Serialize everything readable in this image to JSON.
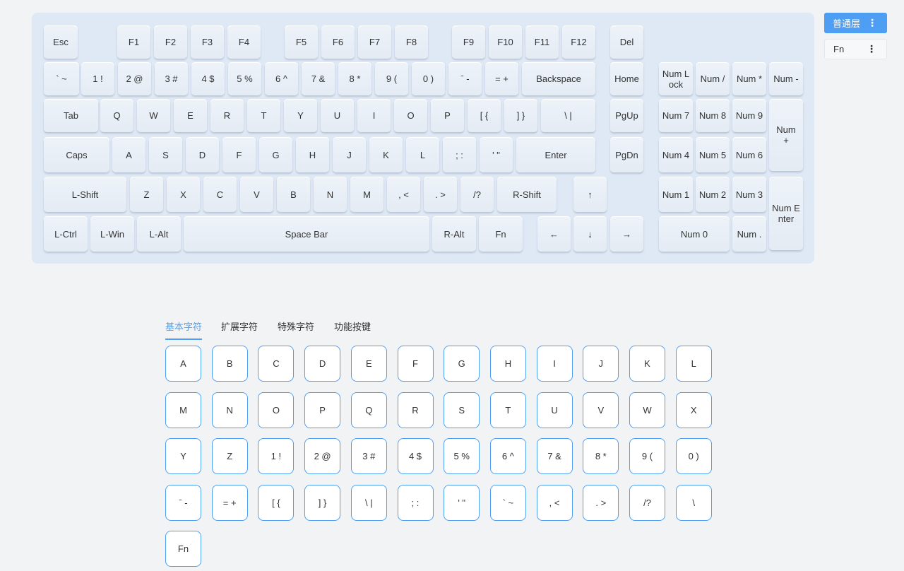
{
  "keyboard": {
    "keys": [
      {
        "id": "esc",
        "label": "Esc"
      },
      {
        "id": "f1",
        "label": "F1"
      },
      {
        "id": "f2",
        "label": "F2"
      },
      {
        "id": "f3",
        "label": "F3"
      },
      {
        "id": "f4",
        "label": "F4"
      },
      {
        "id": "f5",
        "label": "F5"
      },
      {
        "id": "f6",
        "label": "F6"
      },
      {
        "id": "f7",
        "label": "F7"
      },
      {
        "id": "f8",
        "label": "F8"
      },
      {
        "id": "f9",
        "label": "F9"
      },
      {
        "id": "f10",
        "label": "F10"
      },
      {
        "id": "f11",
        "label": "F11"
      },
      {
        "id": "f12",
        "label": "F12"
      },
      {
        "id": "del",
        "label": "Del"
      },
      {
        "id": "backtick",
        "label": "` ~"
      },
      {
        "id": "1",
        "label": "1 !"
      },
      {
        "id": "2",
        "label": "2 @"
      },
      {
        "id": "3",
        "label": "3 #"
      },
      {
        "id": "4",
        "label": "4 $"
      },
      {
        "id": "5",
        "label": "5 %"
      },
      {
        "id": "6",
        "label": "6 ^"
      },
      {
        "id": "7",
        "label": "7 &"
      },
      {
        "id": "8",
        "label": "8 *"
      },
      {
        "id": "9",
        "label": "9 ("
      },
      {
        "id": "0",
        "label": "0 )"
      },
      {
        "id": "minus",
        "label": "ˉ -"
      },
      {
        "id": "equal",
        "label": "= +"
      },
      {
        "id": "backspace",
        "label": "Backspace"
      },
      {
        "id": "home",
        "label": "Home"
      },
      {
        "id": "numlock",
        "label": "Num L\nock"
      },
      {
        "id": "numslash",
        "label": "Num /"
      },
      {
        "id": "numstar",
        "label": "Num *"
      },
      {
        "id": "numminus",
        "label": "Num -"
      },
      {
        "id": "tab",
        "label": "Tab"
      },
      {
        "id": "q",
        "label": "Q"
      },
      {
        "id": "w",
        "label": "W"
      },
      {
        "id": "e",
        "label": "E"
      },
      {
        "id": "r",
        "label": "R"
      },
      {
        "id": "t",
        "label": "T"
      },
      {
        "id": "y",
        "label": "Y"
      },
      {
        "id": "u",
        "label": "U"
      },
      {
        "id": "i",
        "label": "I"
      },
      {
        "id": "o",
        "label": "O"
      },
      {
        "id": "p",
        "label": "P"
      },
      {
        "id": "lbracket",
        "label": "[ {"
      },
      {
        "id": "rbracket",
        "label": "] }"
      },
      {
        "id": "backslash",
        "label": "\\ |"
      },
      {
        "id": "pgup",
        "label": "PgUp"
      },
      {
        "id": "num7",
        "label": "Num 7"
      },
      {
        "id": "num8",
        "label": "Num 8"
      },
      {
        "id": "num9",
        "label": "Num 9"
      },
      {
        "id": "numplus",
        "label": "Num\n+"
      },
      {
        "id": "caps",
        "label": "Caps"
      },
      {
        "id": "a",
        "label": "A"
      },
      {
        "id": "s",
        "label": "S"
      },
      {
        "id": "d",
        "label": "D"
      },
      {
        "id": "f",
        "label": "F"
      },
      {
        "id": "g",
        "label": "G"
      },
      {
        "id": "h",
        "label": "H"
      },
      {
        "id": "j",
        "label": "J"
      },
      {
        "id": "k",
        "label": "K"
      },
      {
        "id": "l",
        "label": "L"
      },
      {
        "id": "semicolon",
        "label": "; :"
      },
      {
        "id": "quote",
        "label": "' \""
      },
      {
        "id": "enter",
        "label": "Enter"
      },
      {
        "id": "pgdn",
        "label": "PgDn"
      },
      {
        "id": "num4",
        "label": "Num 4"
      },
      {
        "id": "num5",
        "label": "Num 5"
      },
      {
        "id": "num6",
        "label": "Num 6"
      },
      {
        "id": "lshift",
        "label": "L-Shift"
      },
      {
        "id": "z",
        "label": "Z"
      },
      {
        "id": "x",
        "label": "X"
      },
      {
        "id": "c",
        "label": "C"
      },
      {
        "id": "v",
        "label": "V"
      },
      {
        "id": "b",
        "label": "B"
      },
      {
        "id": "n",
        "label": "N"
      },
      {
        "id": "m",
        "label": "M"
      },
      {
        "id": "comma",
        "label": ", <"
      },
      {
        "id": "period",
        "label": ". >"
      },
      {
        "id": "slash",
        "label": "/?"
      },
      {
        "id": "rshift",
        "label": "R-Shift"
      },
      {
        "id": "up",
        "label": "↑"
      },
      {
        "id": "num1",
        "label": "Num 1"
      },
      {
        "id": "num2",
        "label": "Num 2"
      },
      {
        "id": "num3",
        "label": "Num 3"
      },
      {
        "id": "numenter",
        "label": "Num E\nnter"
      },
      {
        "id": "lctrl",
        "label": "L-Ctrl"
      },
      {
        "id": "lwin",
        "label": "L-Win"
      },
      {
        "id": "lalt",
        "label": "L-Alt"
      },
      {
        "id": "space",
        "label": "Space Bar"
      },
      {
        "id": "ralt",
        "label": "R-Alt"
      },
      {
        "id": "fn",
        "label": "Fn"
      },
      {
        "id": "left",
        "label": "←"
      },
      {
        "id": "down",
        "label": "↓"
      },
      {
        "id": "right",
        "label": "→"
      },
      {
        "id": "num0",
        "label": "Num 0"
      },
      {
        "id": "numdot",
        "label": "Num ."
      }
    ]
  },
  "layers": {
    "normal_label": "普通层",
    "fn_label": "Fn",
    "menu_icon": "more-vertical-icon",
    "active_color": "#4e9ff3"
  },
  "tabs": [
    {
      "label": "基本字符",
      "active": true
    },
    {
      "label": "扩展字符",
      "active": false
    },
    {
      "label": "特殊字符",
      "active": false
    },
    {
      "label": "功能按键",
      "active": false
    }
  ],
  "char_grid": [
    "A",
    "B",
    "C",
    "D",
    "E",
    "F",
    "G",
    "H",
    "I",
    "J",
    "K",
    "L",
    "M",
    "N",
    "O",
    "P",
    "Q",
    "R",
    "S",
    "T",
    "U",
    "V",
    "W",
    "X",
    "Y",
    "Z",
    "1 !",
    "2 @",
    "3 #",
    "4 $",
    "5 %",
    "6 ^",
    "7 &",
    "8 *",
    "9 (",
    "0 )",
    "ˉ -",
    "= +",
    "[ {",
    "] }",
    "\\ |",
    "; :",
    "' \"",
    "` ~",
    ", <",
    ". >",
    "/?",
    "\\",
    "Fn"
  ]
}
